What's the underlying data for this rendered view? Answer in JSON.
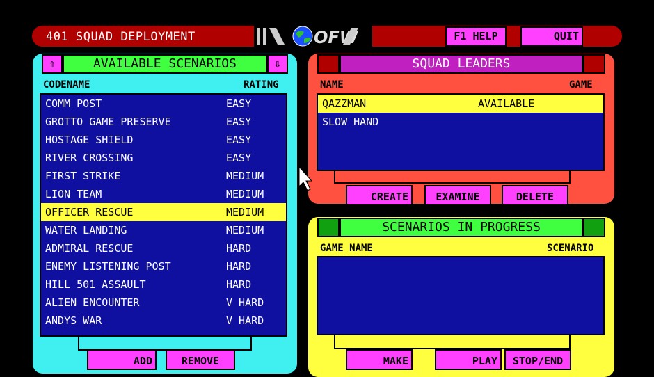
{
  "titlebar": {
    "page_number": "401",
    "title": "SQUAD DEPLOYMENT",
    "logo_text": "OFW",
    "help_label": "F1 HELP",
    "quit_label": "QUIT"
  },
  "available": {
    "header": "AVAILABLE SCENARIOS",
    "col_codename": "CODENAME",
    "col_rating": "RATING",
    "scroll_up_icon": "up-arrow-icon",
    "scroll_down_icon": "down-arrow-icon",
    "rows": [
      {
        "name": "COMM POST",
        "rating": "EASY"
      },
      {
        "name": "GROTTO GAME PRESERVE",
        "rating": "EASY"
      },
      {
        "name": "HOSTAGE SHIELD",
        "rating": "EASY"
      },
      {
        "name": "RIVER CROSSING",
        "rating": "EASY"
      },
      {
        "name": "FIRST STRIKE",
        "rating": "MEDIUM"
      },
      {
        "name": "LION TEAM",
        "rating": "MEDIUM"
      },
      {
        "name": "OFFICER RESCUE",
        "rating": "MEDIUM"
      },
      {
        "name": "WATER LANDING",
        "rating": "MEDIUM"
      },
      {
        "name": "ADMIRAL RESCUE",
        "rating": "HARD"
      },
      {
        "name": "ENEMY LISTENING POST",
        "rating": "HARD"
      },
      {
        "name": "HILL 501 ASSAULT",
        "rating": "HARD"
      },
      {
        "name": "ALIEN ENCOUNTER",
        "rating": "V HARD"
      },
      {
        "name": "ANDYS WAR",
        "rating": "V HARD"
      }
    ],
    "selected_index": 6,
    "add_label": "ADD",
    "remove_label": "REMOVE"
  },
  "leaders": {
    "header": "SQUAD LEADERS",
    "col_name": "NAME",
    "col_game": "GAME",
    "rows": [
      {
        "name": "QAZZMAN",
        "game": "AVAILABLE"
      },
      {
        "name": "SLOW HAND",
        "game": ""
      }
    ],
    "selected_index": 0,
    "create_label": "CREATE",
    "examine_label": "EXAMINE",
    "delete_label": "DELETE"
  },
  "progress": {
    "header": "SCENARIOS IN PROGRESS",
    "col_game_name": "GAME NAME",
    "col_scenario": "SCENARIO",
    "make_label": "MAKE",
    "play_label": "PLAY",
    "stop_label": "STOP/END"
  },
  "colors": {
    "title_red": "#b00000",
    "cyan_panel": "#40f0f0",
    "red_panel": "#ff5040",
    "yellow_panel": "#ffff40",
    "header_green": "#40ff40",
    "leaders_header_purple": "#c020c0",
    "button_magenta": "#ff40ff",
    "list_blue": "#1010a0",
    "selection_yellow": "#ffff40"
  }
}
